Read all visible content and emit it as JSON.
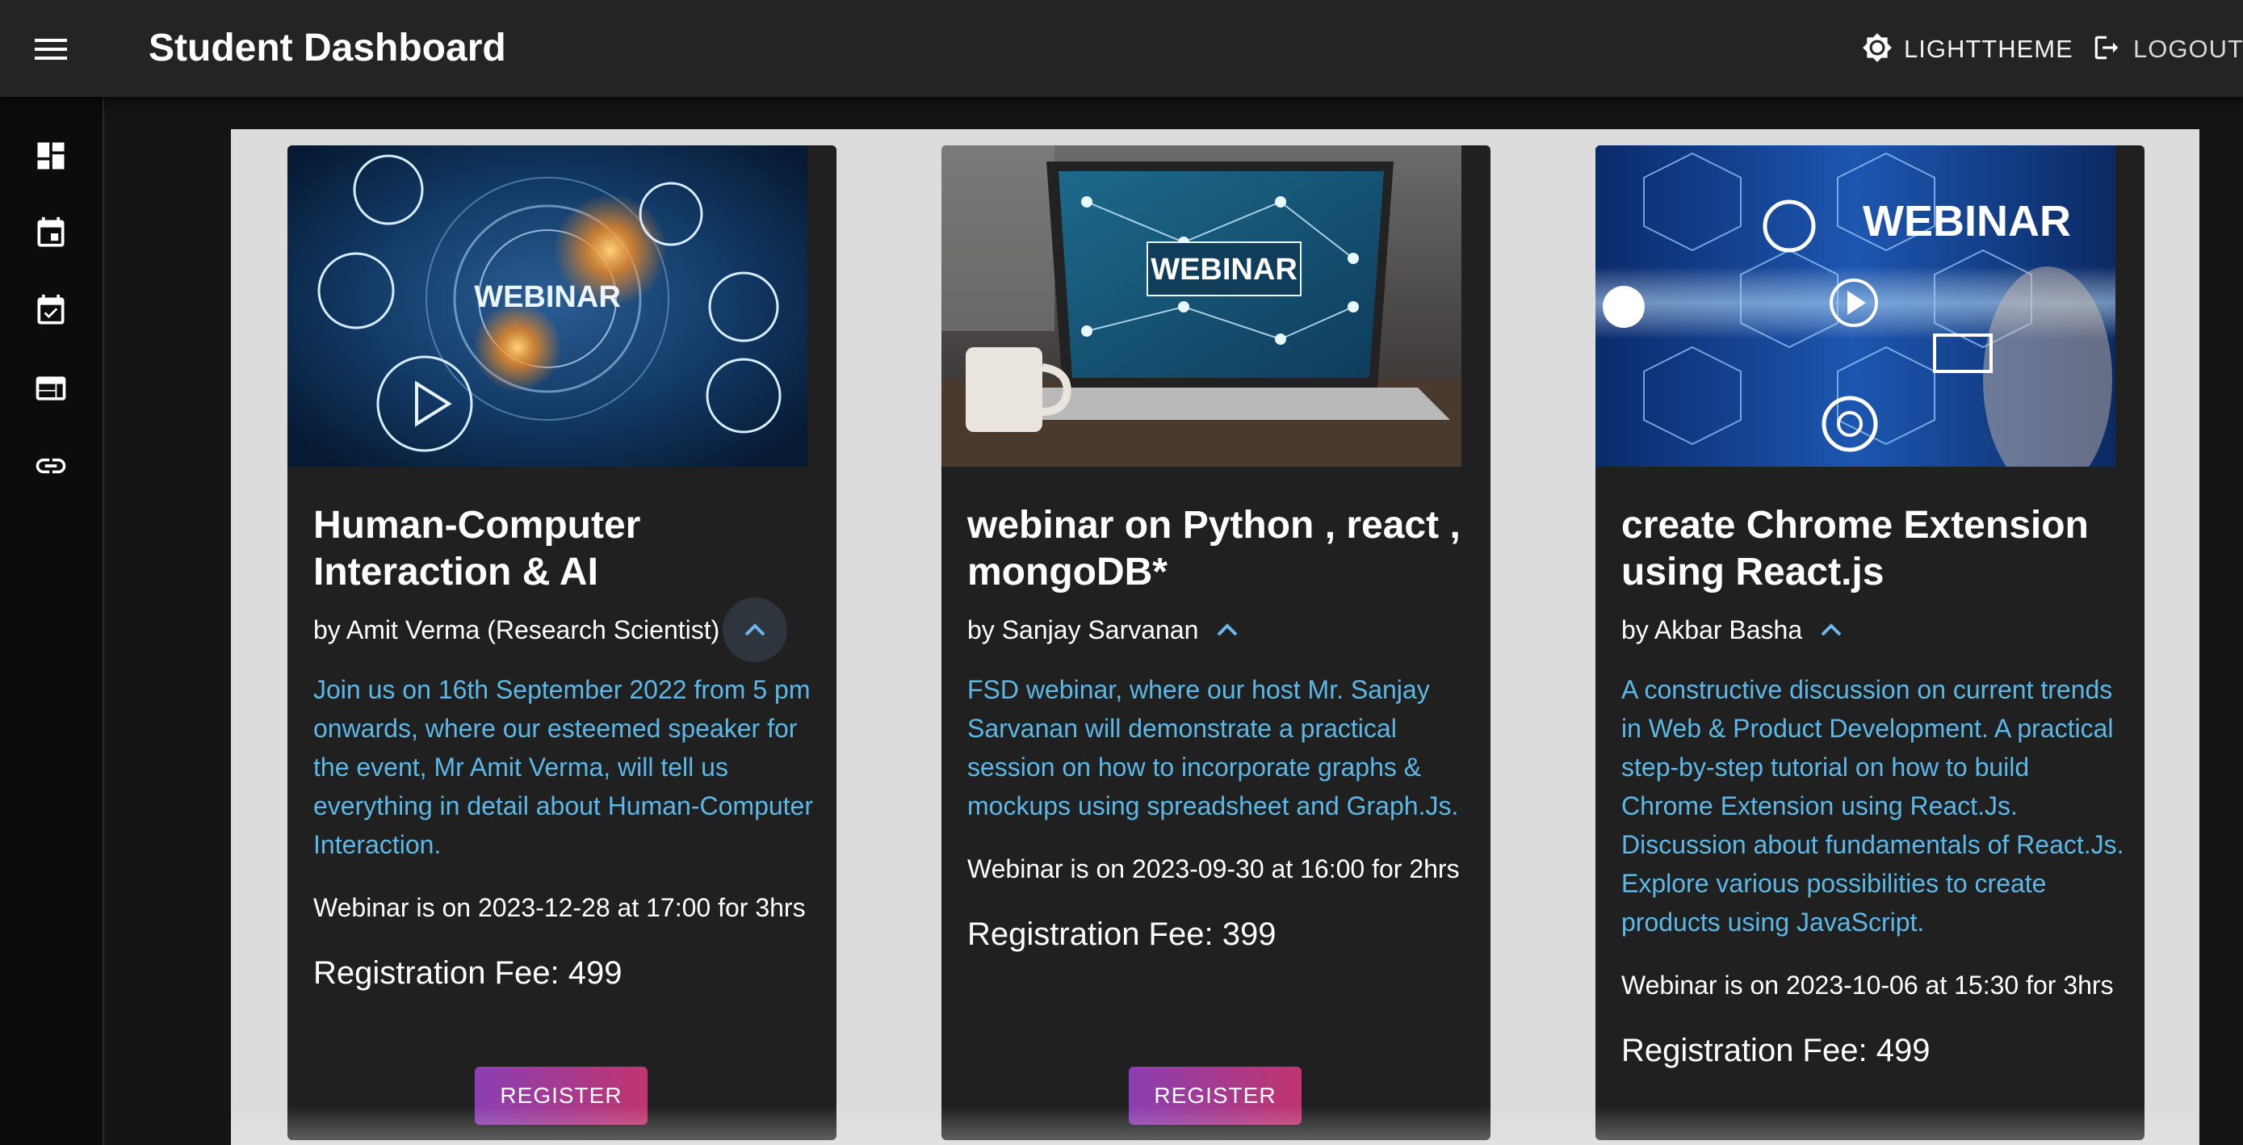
{
  "header": {
    "title": "Student Dashboard",
    "theme_label": "LIGHTTHEME",
    "logout_label": "LOGOUT"
  },
  "sidebar": {
    "items": [
      {
        "name": "dashboard-icon"
      },
      {
        "name": "calendar-icon"
      },
      {
        "name": "event-available-icon"
      },
      {
        "name": "web-layout-icon"
      },
      {
        "name": "link-icon"
      }
    ]
  },
  "cards": [
    {
      "media_text": "WEBINAR",
      "title": "Human-Computer Interaction & AI",
      "author": "by Amit Verma (Research Scientist)",
      "description": "Join us on 16th September 2022 from 5 pm onwards, where our esteemed speaker for the event, Mr Amit Verma, will tell us everything in detail about Human-Computer Interaction.",
      "schedule": "Webinar is on 2023-12-28 at 17:00 for 3hrs",
      "fee": "Registration Fee: 499",
      "register_label": "REGISTER"
    },
    {
      "media_text": "WEBINAR",
      "title": "webinar on Python , react , mongoDB*",
      "author": "by Sanjay Sarvanan",
      "description": "FSD webinar, where our host Mr. Sanjay Sarvanan will demonstrate a practical session on how to incorporate graphs & mockups using spreadsheet and Graph.Js.",
      "schedule": "Webinar is on 2023-09-30 at 16:00 for 2hrs",
      "fee": "Registration Fee: 399",
      "register_label": "REGISTER"
    },
    {
      "media_text": "WEBINAR",
      "title": "create Chrome Extension using React.js",
      "author": "by Akbar Basha",
      "description": "A constructive discussion on current trends in Web & Product Development. A practical step-by-step tutorial on how to build Chrome Extension using React.Js. Discussion about fundamentals of React.Js. Explore various possibilities to create products using JavaScript.",
      "schedule": "Webinar is on 2023-10-06 at 15:30 for 3hrs",
      "fee": "Registration Fee: 499"
    }
  ],
  "colors": {
    "appbar": "#242424",
    "sidebar": "#0c0c0c",
    "panel": "#dcdcdc",
    "card": "#202020",
    "description_text": "#5cb8e6",
    "button_gradient_start": "#8a3fb2",
    "button_gradient_end": "#c0356f"
  }
}
